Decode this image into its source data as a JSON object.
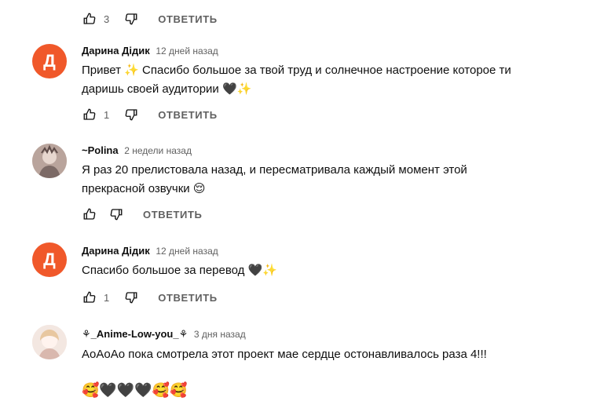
{
  "colors": {
    "avatar_letter_bg": "#f0582a",
    "text": "#0f0f0f",
    "muted": "#606060"
  },
  "top_actions": {
    "likes": "3",
    "reply_label": "ОТВЕТИТЬ"
  },
  "comments": [
    {
      "author": "Дарина Дідик",
      "time": "12 дней назад",
      "avatar": {
        "type": "letter",
        "letter": "Д"
      },
      "text_line1": "Привет ✨ Спасибо большое за твой труд и солнечное настроение которое ти",
      "text_line2": "даришь своей аудитории 🖤✨",
      "likes": "1",
      "reply_label": "ОТВЕТИТЬ"
    },
    {
      "author": "~Polina",
      "time": "2 недели назад",
      "avatar": {
        "type": "image",
        "icon": "avatar-photo-icon"
      },
      "text_line1": "Я раз 20 прелистовала назад, и пересматривала каждый момент этой",
      "text_line2": "прекрасной озвучки 😌",
      "likes": "",
      "reply_label": "ОТВЕТИТЬ"
    },
    {
      "author": "Дарина Дідик",
      "time": "12 дней назад",
      "avatar": {
        "type": "letter",
        "letter": "Д"
      },
      "text_line1": "Спасибо большое за перевод 🖤✨",
      "likes": "1",
      "reply_label": "ОТВЕТИТЬ"
    },
    {
      "author": "⚘_Anime-Low-you_⚘",
      "time": "3 дня назад",
      "avatar": {
        "type": "image",
        "icon": "avatar-anime-icon"
      },
      "text_line1": "АоАоАо пока смотрела этот проект мае сердце остонавливалось раза 4!!!",
      "text_line3": "🥰🖤🖤🖤🥰🥰"
    }
  ]
}
